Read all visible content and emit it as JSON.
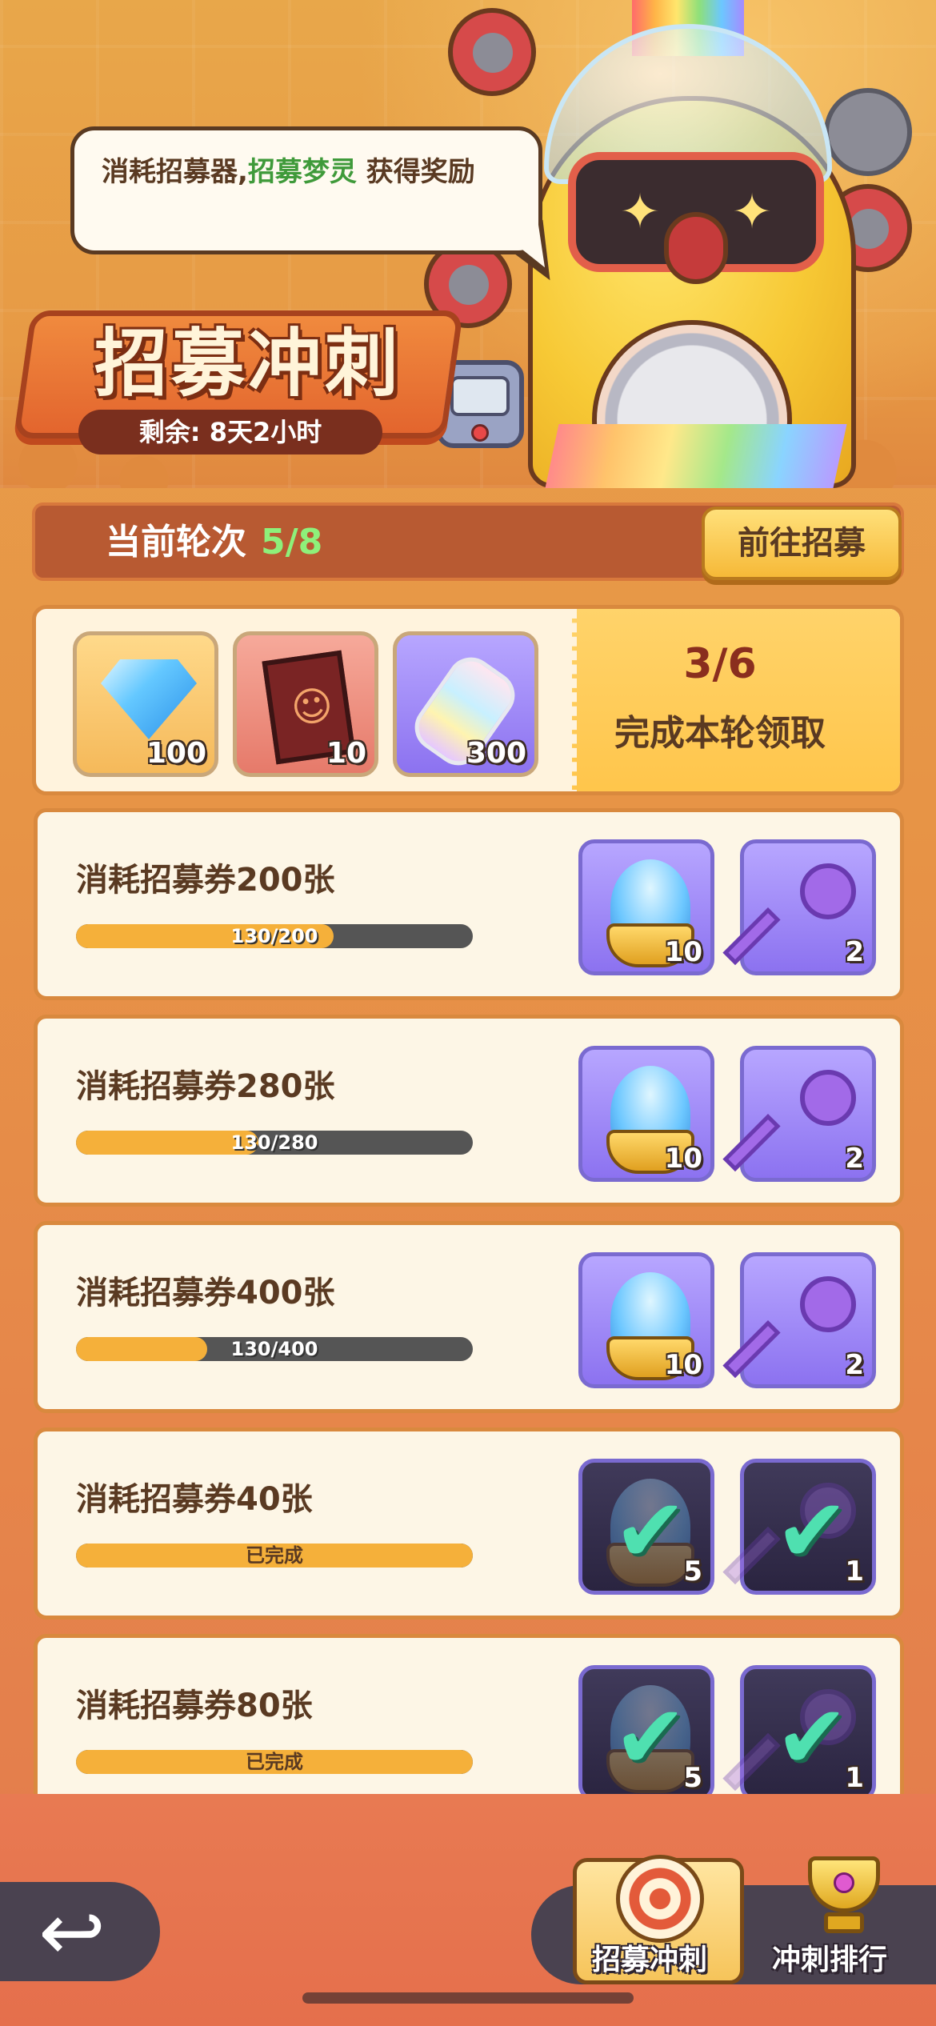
{
  "hero": {
    "bubble": {
      "text_before": "消耗招募器,",
      "highlight": "招募梦灵",
      "text_after": " 获得奖励"
    },
    "title": "招募冲刺",
    "remaining": "剩余: 8天2小时"
  },
  "round": {
    "label": "当前轮次",
    "value": "5/8",
    "go_button": "前往招募"
  },
  "round_rewards": {
    "items": [
      {
        "icon": "diamond-icon",
        "qty": "100"
      },
      {
        "icon": "hero-card-icon",
        "qty": "10"
      },
      {
        "icon": "rainbow-bottle-icon",
        "qty": "300"
      }
    ],
    "progress": "3/6",
    "claim_label": "完成本轮领取"
  },
  "tasks": [
    {
      "title": "消耗招募券200张",
      "progress_label": "130/200",
      "progress": 0.65,
      "rewards": [
        {
          "icon": "spirit-incubator-icon",
          "qty": "10"
        },
        {
          "icon": "purple-key-icon",
          "qty": "2"
        }
      ],
      "completed": false
    },
    {
      "title": "消耗招募券280张",
      "progress_label": "130/280",
      "progress": 0.464,
      "rewards": [
        {
          "icon": "spirit-incubator-icon",
          "qty": "10"
        },
        {
          "icon": "purple-key-icon",
          "qty": "2"
        }
      ],
      "completed": false
    },
    {
      "title": "消耗招募券400张",
      "progress_label": "130/400",
      "progress": 0.325,
      "rewards": [
        {
          "icon": "spirit-incubator-icon",
          "qty": "10"
        },
        {
          "icon": "purple-key-icon",
          "qty": "2"
        }
      ],
      "completed": false
    },
    {
      "title": "消耗招募券40张",
      "progress_label": "已完成",
      "progress": 1.0,
      "rewards": [
        {
          "icon": "spirit-incubator-icon",
          "qty": "5"
        },
        {
          "icon": "purple-key-icon",
          "qty": "1"
        }
      ],
      "completed": true
    },
    {
      "title": "消耗招募券80张",
      "progress_label": "已完成",
      "progress": 1.0,
      "rewards": [
        {
          "icon": "spirit-incubator-icon",
          "qty": "5"
        },
        {
          "icon": "purple-key-icon",
          "qty": "1"
        }
      ],
      "completed": true
    }
  ],
  "bottom_nav": {
    "back_icon": "back-arrow-icon",
    "tabs": [
      {
        "label": "招募冲刺",
        "icon": "target-icon",
        "active": true
      },
      {
        "label": "冲刺排行",
        "icon": "trophy-icon",
        "active": false
      }
    ]
  },
  "colors": {
    "accent_green": "#3f9a3a",
    "progress_fill": "#f5b03a",
    "round_value": "#8ef07a",
    "claim_progress": "#8a2e1e"
  }
}
